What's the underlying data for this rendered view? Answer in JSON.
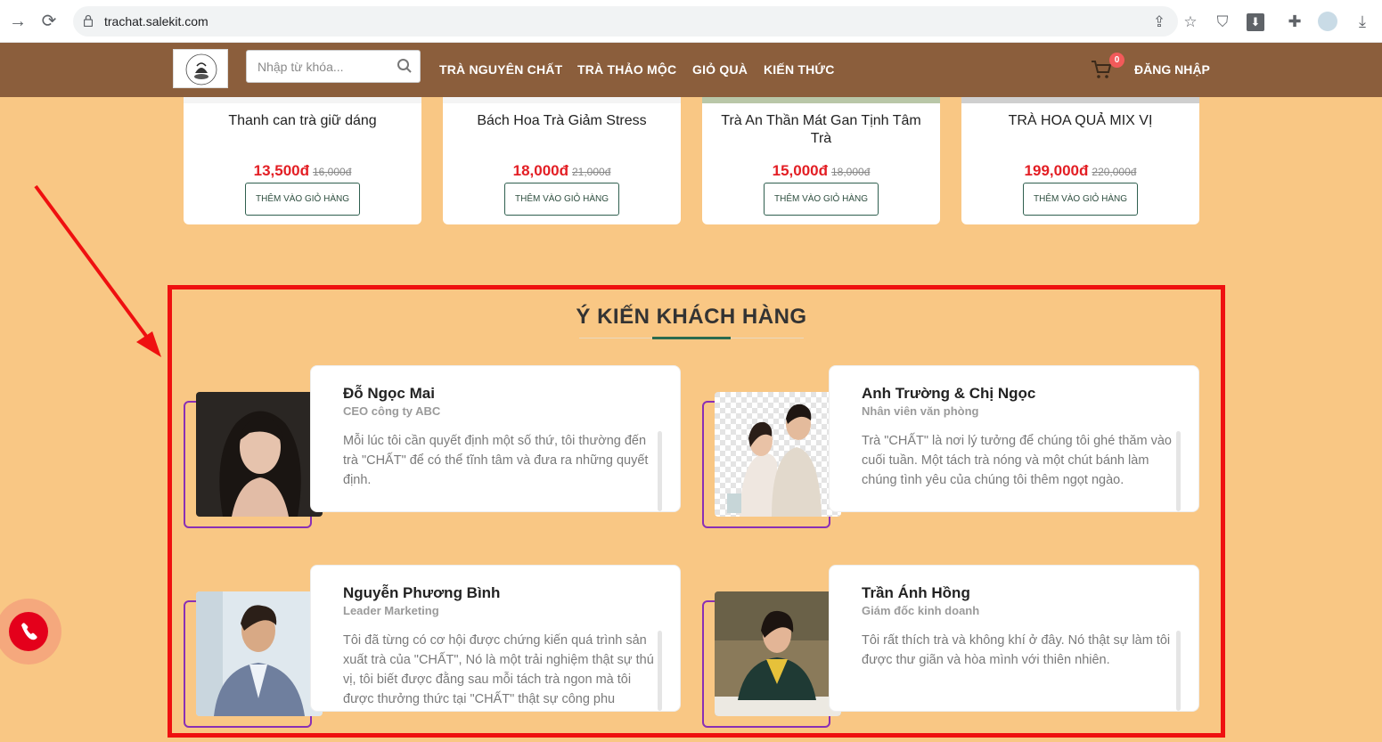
{
  "browser": {
    "url": "trachat.salekit.com"
  },
  "header": {
    "search_placeholder": "Nhập từ khóa...",
    "menu": [
      "TRÀ NGUYÊN CHẤT",
      "TRÀ THẢO MỘC",
      "GIỎ QUÀ",
      "KIẾN THỨC"
    ],
    "cart_count": "0",
    "login": "ĐĂNG NHẬP",
    "brand_color": "#8b5e3c"
  },
  "products": [
    {
      "name": "Thanh can trà giữ dáng",
      "price": "13,500đ",
      "old_price": "16,000đ",
      "button": "THÊM VÀO GIỎ HÀNG"
    },
    {
      "name": "Bách Hoa Trà Giảm Stress",
      "price": "18,000đ",
      "old_price": "21,000đ",
      "button": "THÊM VÀO GIỎ HÀNG"
    },
    {
      "name": "Trà An Thần Mát Gan Tịnh Tâm Trà",
      "price": "15,000đ",
      "old_price": "18,000đ",
      "button": "THÊM VÀO GIỎ HÀNG"
    },
    {
      "name": "TRÀ HOA QUẢ MIX VỊ",
      "price": "199,000đ",
      "old_price": "220,000đ",
      "button": "THÊM VÀO GIỎ HÀNG"
    }
  ],
  "testimonials": {
    "title": "Ý KIẾN KHÁCH HÀNG",
    "items": [
      {
        "name": "Đỗ Ngọc Mai",
        "role": "CEO công ty ABC",
        "quote": "Mỗi lúc tôi cần quyết định một số thứ, tôi thường đến trà \"CHẤT\" để có thể tĩnh tâm và đưa ra những quyết định."
      },
      {
        "name": "Anh Trường & Chị Ngọc",
        "role": "Nhân viên văn phòng",
        "quote": "Trà \"CHẤT\" là nơi lý tưởng để chúng tôi ghé thăm vào cuối tuần. Một tách trà nóng và một chút bánh làm chúng tình yêu của chúng tôi thêm ngọt ngào."
      },
      {
        "name": "Nguyễn Phương Bình",
        "role": "Leader Marketing",
        "quote": "Tôi đã từng có cơ hội được chứng kiến quá trình sản xuất trà của \"CHẤT\", Nó là một trải nghiệm thật sự thú vị, tôi biết được đằng sau mỗi tách trà ngon mà tôi được thưởng thức tại \"CHẤT\" thật sự công phu"
      },
      {
        "name": "Trần Ánh Hồng",
        "role": "Giám đốc kinh doanh",
        "quote": "Tôi rất thích trà và không khí ở đây. Nó thật sự làm tôi được thư giãn và hòa mình với thiên nhiên."
      }
    ]
  },
  "colors": {
    "page_bg": "#f9c784",
    "price_red": "#e31e24",
    "annotation_red": "#ef1010",
    "frame_purple": "#8a2fb5",
    "accent_green": "#2b6b4f"
  }
}
